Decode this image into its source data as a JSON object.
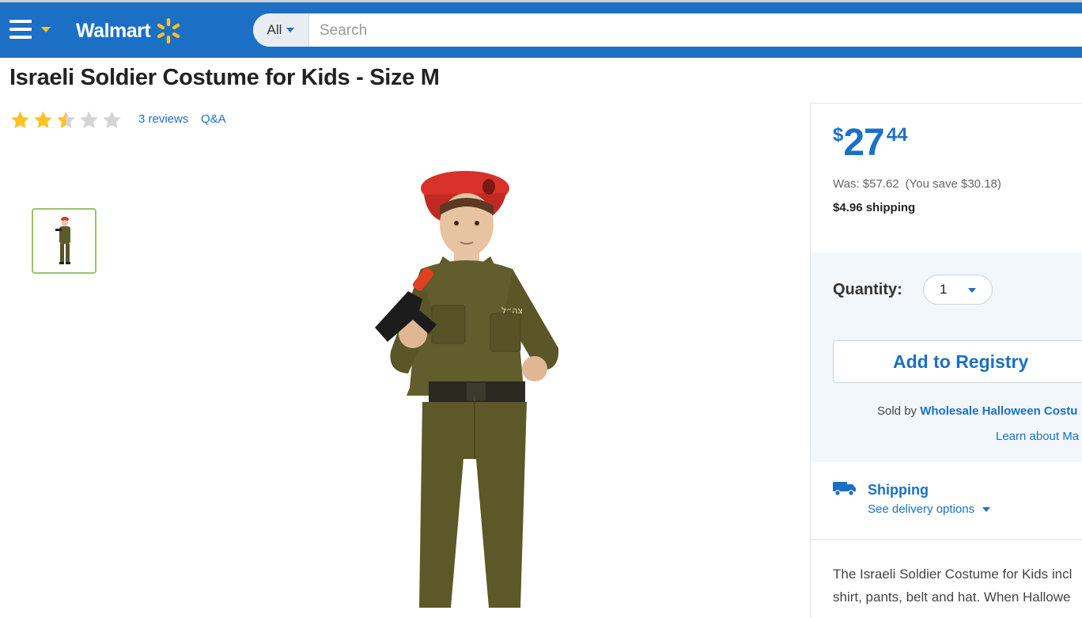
{
  "header": {
    "logo_text": "Walmart",
    "search": {
      "department": "All",
      "placeholder": "Search"
    }
  },
  "product": {
    "title": "Israeli Soldier Costume for Kids - Size M",
    "rating": {
      "value": 2.5,
      "max": 5
    },
    "reviews_label": "3 reviews",
    "qa_label": "Q&A",
    "price": {
      "currency": "$",
      "dollars": "27",
      "cents": "44"
    },
    "was": "Was: $57.62",
    "savings": "(You save $30.18)",
    "shipping_cost": "$4.96 shipping",
    "quantity": {
      "label": "Quantity:",
      "value": "1"
    },
    "registry_button": "Add to Registry",
    "sold_by_prefix": "Sold by",
    "seller": "Wholesale Halloween Costu",
    "learn_more": "Learn about Ma",
    "shipping": {
      "title": "Shipping",
      "delivery_link": "See delivery options"
    },
    "description_lines": [
      "The Israeli Soldier Costume for Kids incl",
      "shirt, pants, belt and hat. When Hallowe"
    ]
  },
  "colors": {
    "brand_blue": "#1b70c6",
    "spark_yellow": "#ffc220",
    "star_filled": "#ffc220",
    "star_empty": "#d4d4d4",
    "thumb_border": "#9bc26a"
  },
  "icons": {
    "menu": "hamburger-icon",
    "spark": "walmart-spark-icon",
    "truck": "truck-icon"
  }
}
